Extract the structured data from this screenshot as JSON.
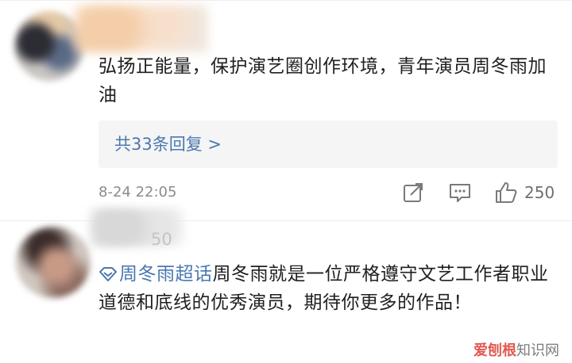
{
  "comments": [
    {
      "text": "弘扬正能量，保护演艺圈创作环境，青年演员周冬雨加油",
      "reply_label": "共33条回复 >",
      "time": "8-24 22:05",
      "likes": "250",
      "icons": [
        "share-icon",
        "comment-icon",
        "like-icon"
      ]
    },
    {
      "username_fragment": "50",
      "topic": "周冬雨超话",
      "text": "周冬雨就是一位严格遵守文艺工作者职业道德和底线的优秀演员，期待你更多的作品！"
    }
  ],
  "watermark": {
    "brand": "爱刨根",
    "rest": "知识网"
  },
  "colors": {
    "link": "#4a78b0",
    "meta": "#8c8c8c",
    "reply_bg": "#f5f5f5"
  }
}
